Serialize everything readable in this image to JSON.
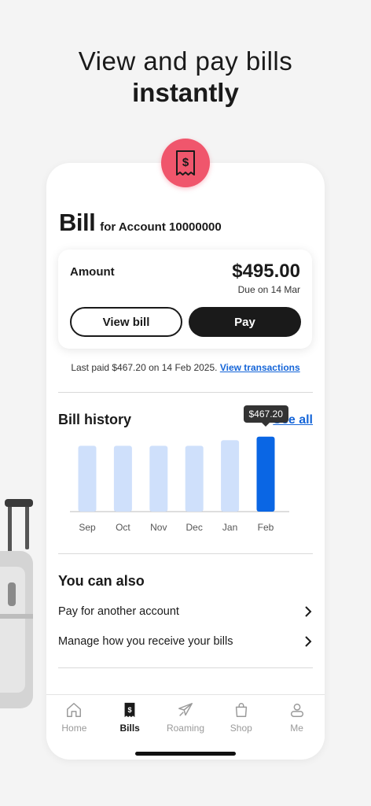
{
  "headline": {
    "line1": "View and pay bills",
    "line2": "instantly"
  },
  "bill": {
    "title": "Bill",
    "account_label": "for Account 10000000"
  },
  "amount_card": {
    "label": "Amount",
    "value": "$495.00",
    "due": "Due on 14 Mar",
    "view_bill_label": "View bill",
    "pay_label": "Pay"
  },
  "last_paid": {
    "text": "Last paid $467.20 on 14 Feb 2025.",
    "link": "View transactions"
  },
  "history": {
    "title": "Bill history",
    "see_all": "See all"
  },
  "chart_data": {
    "type": "bar",
    "categories": [
      "Sep",
      "Oct",
      "Nov",
      "Dec",
      "Jan",
      "Feb"
    ],
    "values": [
      410,
      410,
      410,
      410,
      445,
      467.2
    ],
    "highlight_index": 5,
    "highlight_label": "$467.20",
    "colors": {
      "normal": "#cfe0fb",
      "highlight": "#0a66e4"
    },
    "ylim": [
      0,
      500
    ]
  },
  "also": {
    "title": "You can also",
    "items": [
      {
        "label": "Pay for another account",
        "icon": "chevron-right-icon"
      },
      {
        "label": "Manage how you receive your bills",
        "icon": "chevron-right-icon"
      }
    ]
  },
  "tabs": [
    {
      "label": "Home",
      "icon": "home-icon",
      "active": false
    },
    {
      "label": "Bills",
      "icon": "bill-icon",
      "active": true
    },
    {
      "label": "Roaming",
      "icon": "plane-icon",
      "active": false
    },
    {
      "label": "Shop",
      "icon": "bag-icon",
      "active": false
    },
    {
      "label": "Me",
      "icon": "person-icon",
      "active": false
    }
  ],
  "colors": {
    "accent": "#f0566c",
    "link": "#1565d8",
    "dark": "#1a1a1a"
  }
}
